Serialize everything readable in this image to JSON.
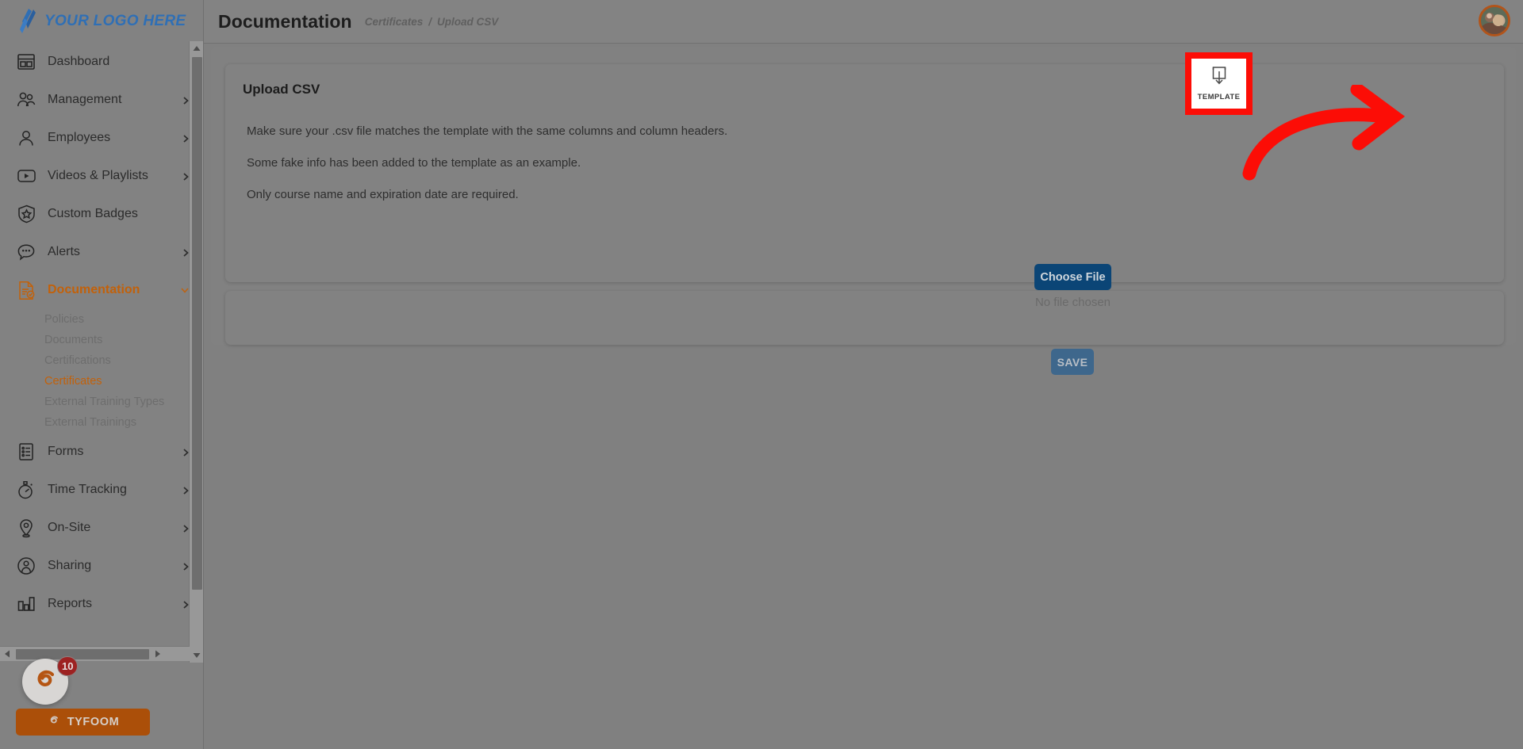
{
  "brand": {
    "logo_text": "YOUR LOGO HERE",
    "logo_icon": "slash-logo-icon",
    "footer_name": "TYFOOM",
    "footer_icon": "tyfoom-swirl-icon",
    "chat_icon": "tyfoom-swirl-icon",
    "chat_badge_count": "10",
    "accent_orange": "#c2610a",
    "logo_blue": "#2f6fb5",
    "footer_bg": "#ab4f09"
  },
  "sidebar": {
    "items": [
      {
        "label": "Dashboard",
        "icon": "dashboard-icon",
        "chevron": false,
        "active": false
      },
      {
        "label": "Management",
        "icon": "users-group-icon",
        "chevron": true,
        "active": false
      },
      {
        "label": "Employees",
        "icon": "user-icon",
        "chevron": true,
        "active": false
      },
      {
        "label": "Videos & Playlists",
        "icon": "video-play-icon",
        "chevron": true,
        "active": false
      },
      {
        "label": "Custom Badges",
        "icon": "shield-star-icon",
        "chevron": false,
        "active": false
      },
      {
        "label": "Alerts",
        "icon": "chat-alert-icon",
        "chevron": true,
        "active": false
      },
      {
        "label": "Documentation",
        "icon": "document-check-icon",
        "chevron": true,
        "active": true
      }
    ],
    "sub_items": [
      {
        "label": "Policies",
        "active": false
      },
      {
        "label": "Documents",
        "active": false
      },
      {
        "label": "Certifications",
        "active": false
      },
      {
        "label": "Certificates",
        "active": true
      },
      {
        "label": "External Training Types",
        "active": false
      },
      {
        "label": "External Trainings",
        "active": false
      }
    ],
    "items_after": [
      {
        "label": "Forms",
        "icon": "form-list-icon",
        "chevron": true
      },
      {
        "label": "Time Tracking",
        "icon": "stopwatch-icon",
        "chevron": true
      },
      {
        "label": "On-Site",
        "icon": "map-pin-icon",
        "chevron": true
      },
      {
        "label": "Sharing",
        "icon": "share-user-icon",
        "chevron": true
      },
      {
        "label": "Reports",
        "icon": "bar-chart-icon",
        "chevron": true
      }
    ],
    "scrollbar_vertical": "sidebar-vertical-scrollbar",
    "scrollbar_horizontal": "sidebar-horizontal-scrollbar"
  },
  "header": {
    "title": "Documentation",
    "breadcrumb": [
      "Certificates",
      "/",
      "Upload CSV"
    ],
    "avatar_icon": "user-avatar-photo"
  },
  "main": {
    "card_title": "Upload CSV",
    "notes": [
      "Make sure your .csv file matches the template with the same columns and column headers.",
      "Some fake info has been added to the template as an example.",
      "Only course name and expiration date are required."
    ],
    "choose_file_label": "Choose File",
    "file_status": "No file chosen",
    "save_label": "SAVE",
    "template_label": "TEMPLATE",
    "template_icon": "download-to-box-icon",
    "choose_file_color": "#0b4576",
    "save_color": "#3e678c"
  },
  "annotations": {
    "arrow": {
      "name": "red-curved-arrow",
      "color": "#fc0d06",
      "points_to": "TEMPLATE"
    },
    "highlight_box": {
      "name": "red-highlight-box",
      "color": "#fc0d06",
      "surrounds": "TEMPLATE"
    }
  }
}
